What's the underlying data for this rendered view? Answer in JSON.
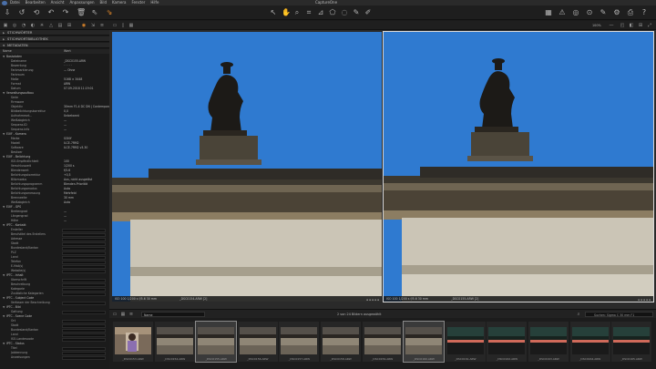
{
  "app": {
    "title": "CaptureOne"
  },
  "menu": [
    "Datei",
    "Bearbeiten",
    "Ansicht",
    "Anpassungen",
    "Bild",
    "Kamera",
    "Fenster",
    "Hilfe"
  ],
  "toolbar": {
    "left_icons": [
      "import-icon",
      "rotate-left-icon",
      "reset-icon",
      "undo-icon",
      "redo-icon",
      "trash-icon",
      "copy-adjustments-icon",
      "apply-adjustments-icon"
    ],
    "center_icons": [
      "pointer-icon",
      "pan-icon",
      "zoom-icon",
      "crop-icon",
      "straighten-icon",
      "keystone-icon",
      "spot-icon",
      "picker-icon",
      "color-picker-icon"
    ],
    "right_icons": [
      "grid-icon",
      "warning-icon",
      "focus-icon",
      "loupe-icon",
      "edit-icon",
      "settings-icon",
      "print-icon",
      "help-icon"
    ]
  },
  "viewer_bar": {
    "zoom": "100%"
  },
  "panels": {
    "stichworter": "STICHWÖRTER",
    "bibliothek": "STICHWORTBIBLIOTHEK",
    "metadaten": "METADATEN"
  },
  "columns": {
    "name": "Name",
    "wert": "Wert"
  },
  "metadata": [
    {
      "k": "Basisdaten",
      "v": "",
      "group": true
    },
    {
      "k": "Dateiname",
      "v": "_DSC0155.ARW"
    },
    {
      "k": "Bewertung",
      "v": "· · · · ·"
    },
    {
      "k": "Farbmarkierung",
      "v": "— Ohne"
    },
    {
      "k": "Farbraum",
      "v": ""
    },
    {
      "k": "Maße",
      "v": "5168 × 3448"
    },
    {
      "k": "Format",
      "v": "ARW"
    },
    {
      "k": "Datum",
      "v": "07.09.2018 11:19:01"
    },
    {
      "k": "Verwaltungsaufbau",
      "v": "",
      "group": true
    },
    {
      "k": "Serie",
      "v": ""
    },
    {
      "k": "Firmware",
      "v": ""
    },
    {
      "k": "Objektiv",
      "v": "30mm F1.4 DC DN | Contemporary 016"
    },
    {
      "k": "Bildbelichtungskorrektur",
      "v": "0,0"
    },
    {
      "k": "Aufnahmeart...",
      "v": "Unbekannt"
    },
    {
      "k": "Weißabgleich",
      "v": "—"
    },
    {
      "k": "Sequenz-ID",
      "v": "—"
    },
    {
      "k": "Sequenz-Info",
      "v": "—"
    },
    {
      "k": "EXIF - Kamera",
      "v": "",
      "group": true
    },
    {
      "k": "Marke",
      "v": "SONY"
    },
    {
      "k": "Modell",
      "v": "ILCE-7RM2"
    },
    {
      "k": "Software",
      "v": "ILCE-7RM2 v3.30"
    },
    {
      "k": "Besitzer",
      "v": ""
    },
    {
      "k": "EXIF - Belichtung",
      "v": "",
      "group": true
    },
    {
      "k": "ISO-Empfindlichkeit",
      "v": "100"
    },
    {
      "k": "Verschlusszeit",
      "v": "1/200 s"
    },
    {
      "k": "Blendenwert",
      "v": "f/5.6"
    },
    {
      "k": "Belichtungskorrektur",
      "v": "+0,3"
    },
    {
      "k": "Blitzmodus",
      "v": "Aus, nicht ausgelöst"
    },
    {
      "k": "Belichtungsprogramm",
      "v": "Blenden-Priorität"
    },
    {
      "k": "Belichtungsmodus",
      "v": "Auto"
    },
    {
      "k": "Belichtungsmessung",
      "v": "Mehrfeld"
    },
    {
      "k": "Brennweite",
      "v": "30 mm"
    },
    {
      "k": "Weißabgleich",
      "v": "Auto"
    },
    {
      "k": "EXIF - GPS",
      "v": "",
      "group": true
    },
    {
      "k": "Breitengrad",
      "v": "—"
    },
    {
      "k": "Längengrad",
      "v": "—"
    },
    {
      "k": "Höhe",
      "v": "—"
    },
    {
      "k": "IPTC - Kontakt",
      "v": "",
      "group": true
    },
    {
      "k": "Ersteller",
      "v": "",
      "field": true
    },
    {
      "k": "Berufstitel des Erstellers",
      "v": "",
      "field": true
    },
    {
      "k": "Adresse",
      "v": "",
      "field": true
    },
    {
      "k": "Stadt",
      "v": "",
      "field": true
    },
    {
      "k": "Bundesland/Kanton",
      "v": "",
      "field": true
    },
    {
      "k": "PLZ",
      "v": "",
      "field": true
    },
    {
      "k": "Land",
      "v": "",
      "field": true
    },
    {
      "k": "Telefon",
      "v": "",
      "field": true
    },
    {
      "k": "E-Mail(s)",
      "v": "",
      "field": true
    },
    {
      "k": "Website(s)",
      "v": "",
      "field": true
    },
    {
      "k": "IPTC - Inhalt",
      "v": "",
      "group": true
    },
    {
      "k": "Überschrift",
      "v": "",
      "field": true
    },
    {
      "k": "Beschreibung",
      "v": "",
      "field": true
    },
    {
      "k": "Kategorie",
      "v": "",
      "field": true
    },
    {
      "k": "Zusätzliche Kategorien",
      "v": "",
      "field": true
    },
    {
      "k": "IPTC - Subject Code",
      "v": "",
      "group": true
    },
    {
      "k": "Verfasser der Beschreibung",
      "v": "",
      "field": true
    },
    {
      "k": "IPTC - Bild",
      "v": "",
      "group": true
    },
    {
      "k": "Gattung",
      "v": "",
      "field": true
    },
    {
      "k": "IPTC - Scene Code",
      "v": "",
      "group": true
    },
    {
      "k": "Ort",
      "v": "",
      "field": true
    },
    {
      "k": "Stadt",
      "v": "",
      "field": true
    },
    {
      "k": "Bundesland/Kanton",
      "v": "",
      "field": true
    },
    {
      "k": "Land",
      "v": "",
      "field": true
    },
    {
      "k": "ISO-Landescode",
      "v": "",
      "field": true
    },
    {
      "k": "IPTC - Status",
      "v": "",
      "group": true
    },
    {
      "k": "Titel",
      "v": "",
      "field": true
    },
    {
      "k": "Jobkennung",
      "v": "",
      "field": true
    },
    {
      "k": "Anweisungen",
      "v": "",
      "field": true
    }
  ],
  "viewer": {
    "left": {
      "info": "ISO 100  1/200 s  f/5.6  30 mm",
      "name": "_DSC0154.ARW [2]"
    },
    "right": {
      "info": "ISO 100  1/200 s  f/5.6  30 mm",
      "name": "_DSC0155.ARW [2]"
    }
  },
  "filmbar": {
    "sort_label": "Name",
    "count": "2 von 24 Bildern ausgewählt",
    "search_placeholder": "Suchen: Sigma C 30 mm F1"
  },
  "thumbnails": [
    {
      "name": "_DSC0153.ARW",
      "kind": "portrait"
    },
    {
      "name": "_DSC0154.ARW",
      "kind": "building"
    },
    {
      "name": "_DSC0155.ARW",
      "kind": "building",
      "selected": true
    },
    {
      "name": "_DSC0156.ARW",
      "kind": "building"
    },
    {
      "name": "_DSC0157.ARW",
      "kind": "building"
    },
    {
      "name": "_DSC0158.ARW",
      "kind": "building"
    },
    {
      "name": "_DSC0159.ARW",
      "kind": "building"
    },
    {
      "name": "_DSC0160.ARW",
      "kind": "building",
      "selected": true
    },
    {
      "name": "_DSC0161.ARW",
      "kind": "night"
    },
    {
      "name": "_DSC0162.ARW",
      "kind": "night"
    },
    {
      "name": "_DSC0163.ARW",
      "kind": "night"
    },
    {
      "name": "_DSC0164.ARW",
      "kind": "night"
    },
    {
      "name": "_DSC0165.ARW",
      "kind": "night"
    }
  ]
}
